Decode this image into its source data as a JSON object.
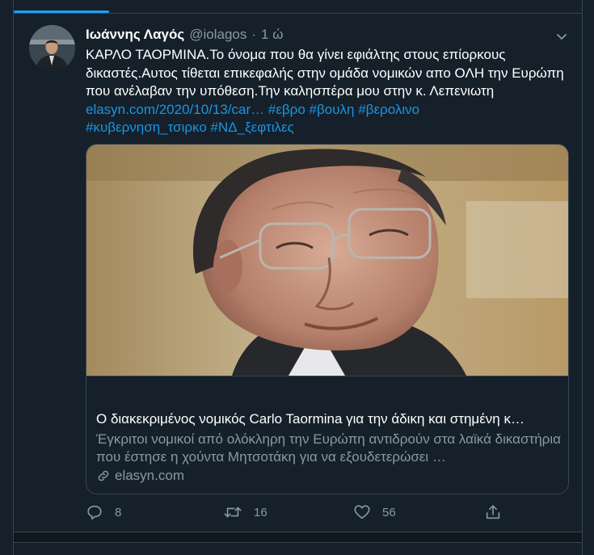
{
  "tweet": {
    "author_name": "Ιωάννης Λαγός",
    "author_handle": "@iolagos",
    "separator": "·",
    "time": "1 ώ",
    "text_plain": "ΚΑΡΛΟ ΤΑΟΡΜΙΝΑ.Το όνομα που θα γίνει εφιάλτης στους επίορκους δικαστές.Αυτος τίθεται επικεφαλής στην ομάδα νομικών απο ΟΛΗ την Ευρώπη που ανέλαβαν την υπόθεση.Την καλησπέρα μου στην κ. Λεπενιωτη",
    "url_text": "elasyn.com/2020/10/13/car…",
    "hashtags": [
      "#εβρο",
      "#βουλη",
      "#βερολινο",
      "#κυβερνηση_τσιρκο",
      "#ΝΔ_ξεφτιλες"
    ]
  },
  "card": {
    "title": "Ο διακεκριμένος νομικός Carlo Taormina για την άδικη και στημένη κ…",
    "description": "Έγκριτοι νομικοί από ολόκληρη την Ευρώπη αντιδρούν στα λαϊκά δικαστήρια που έστησε η χούντα Μητσοτάκη για να εξουδετερώσει …",
    "domain": "elasyn.com"
  },
  "actions": {
    "reply_count": "8",
    "retweet_count": "16",
    "like_count": "56"
  },
  "colors": {
    "background": "#15202b",
    "border": "#38444d",
    "accent": "#1da1f2",
    "link": "#1b95e0",
    "secondary_text": "#8899a6"
  },
  "icons": [
    "chevron-down-icon",
    "reply-icon",
    "retweet-icon",
    "like-icon",
    "share-icon",
    "link-icon"
  ]
}
